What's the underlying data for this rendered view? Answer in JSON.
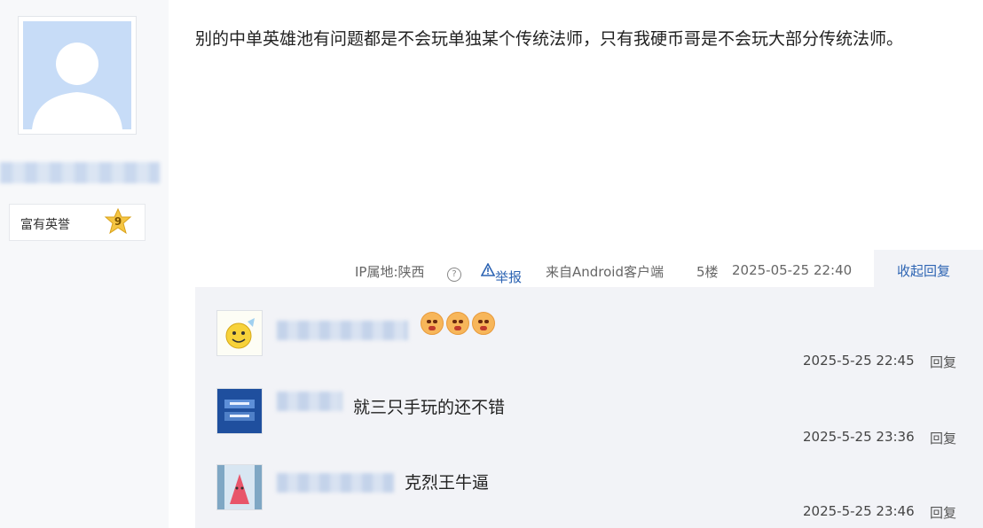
{
  "post": {
    "content": "别的中单英雄池有问题都是不会玩单独某个传统法师，只有我硬币哥是不会玩大部分传统法师。",
    "author": {
      "honor_label": "富有英誉",
      "level": "9",
      "avatar_icon": "default-user-avatar-icon"
    },
    "meta": {
      "ip": "IP属地:陕西",
      "help_icon": "question-circle-icon",
      "report_icon": "warning-triangle-icon",
      "report": "举报",
      "source": "来自Android客户端",
      "floor": "5楼",
      "time": "2025-05-25 22:40",
      "collapse": "收起回复"
    }
  },
  "replies": [
    {
      "emoji_icons": [
        "angry-face-icon",
        "angry-face-icon",
        "angry-face-icon"
      ],
      "text": "",
      "time": "2025-5-25 22:45",
      "action": "回复"
    },
    {
      "text": "就三只手玩的还不错",
      "time": "2025-5-25 23:36",
      "action": "回复"
    },
    {
      "text": "克烈王牛逼",
      "time": "2025-5-25 23:46",
      "action": "回复"
    }
  ],
  "colors": {
    "link": "#2d64b3",
    "reply_bg": "#f2f3f7",
    "avatar_bg": "#c7dcf7"
  }
}
